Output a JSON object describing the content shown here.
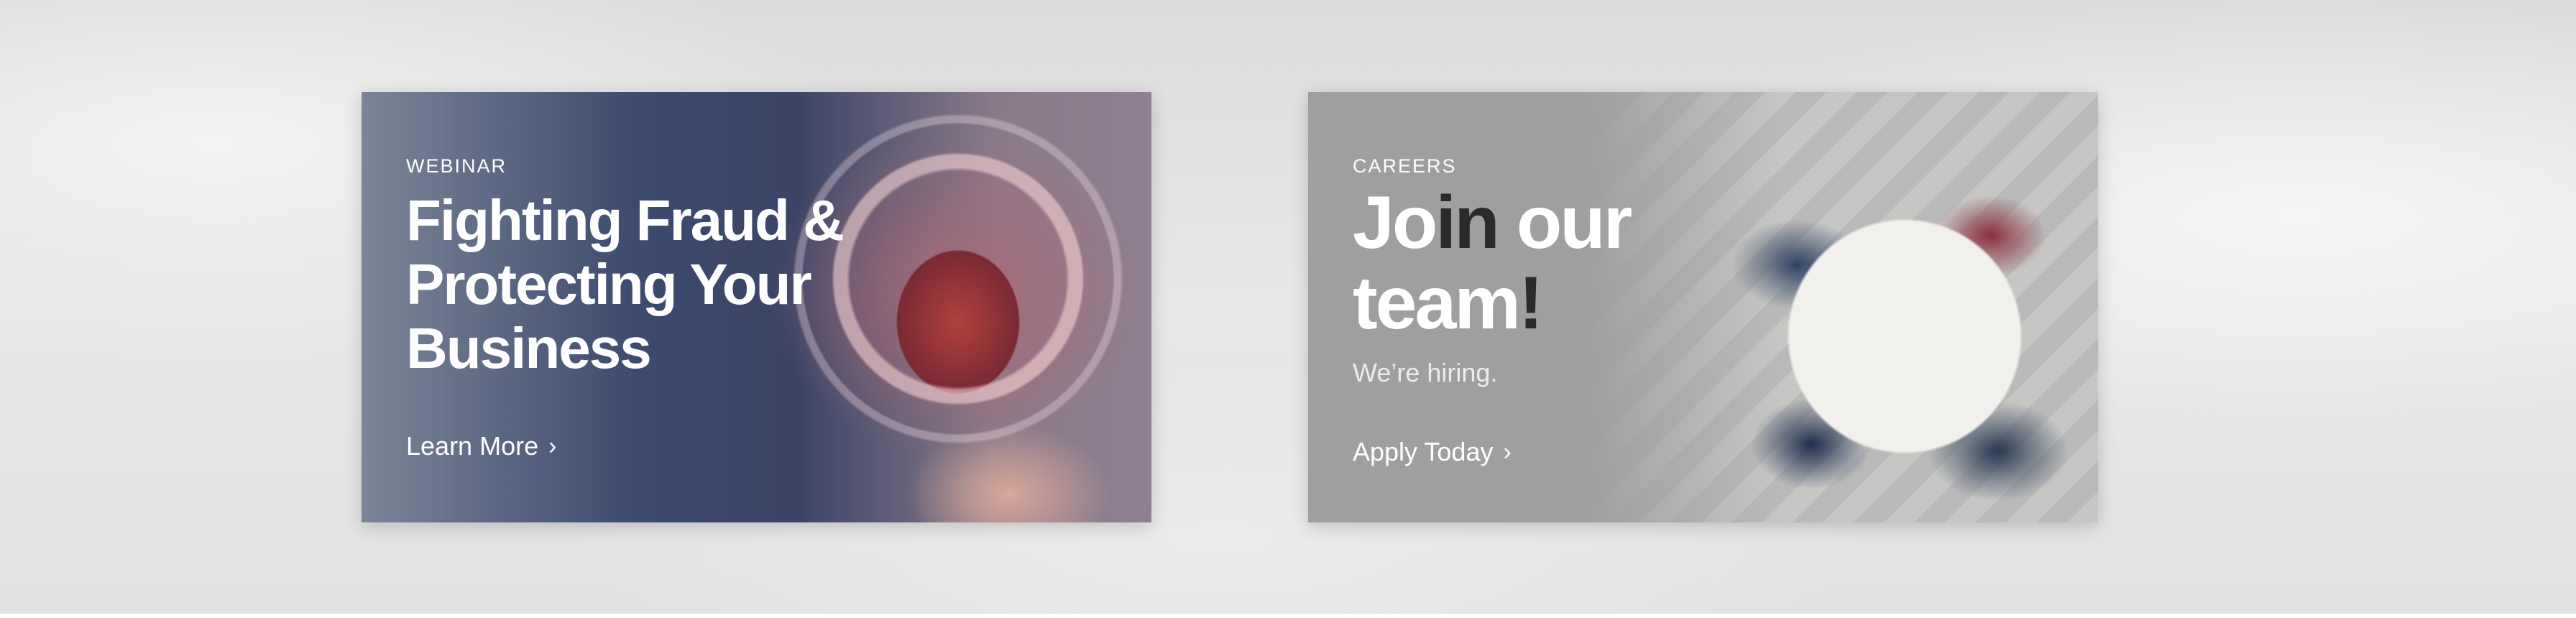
{
  "cards": [
    {
      "eyebrow": "WEBINAR",
      "title_lines": [
        "Fighting Fraud &",
        "Protecting Your",
        "Business"
      ],
      "cta_label": "Learn More",
      "cta_icon": "chevron-right-icon",
      "image": "padlock-hologram-touch"
    },
    {
      "eyebrow": "CAREERS",
      "title_parts": [
        "Jo",
        "in",
        " our",
        "team",
        "!"
      ],
      "subtitle": "We’re hiring.",
      "cta_label": "Apply Today",
      "cta_icon": "chevron-right-icon",
      "image": "team-meeting-round-table",
      "accent_dark": "#2a2a2a"
    }
  ]
}
